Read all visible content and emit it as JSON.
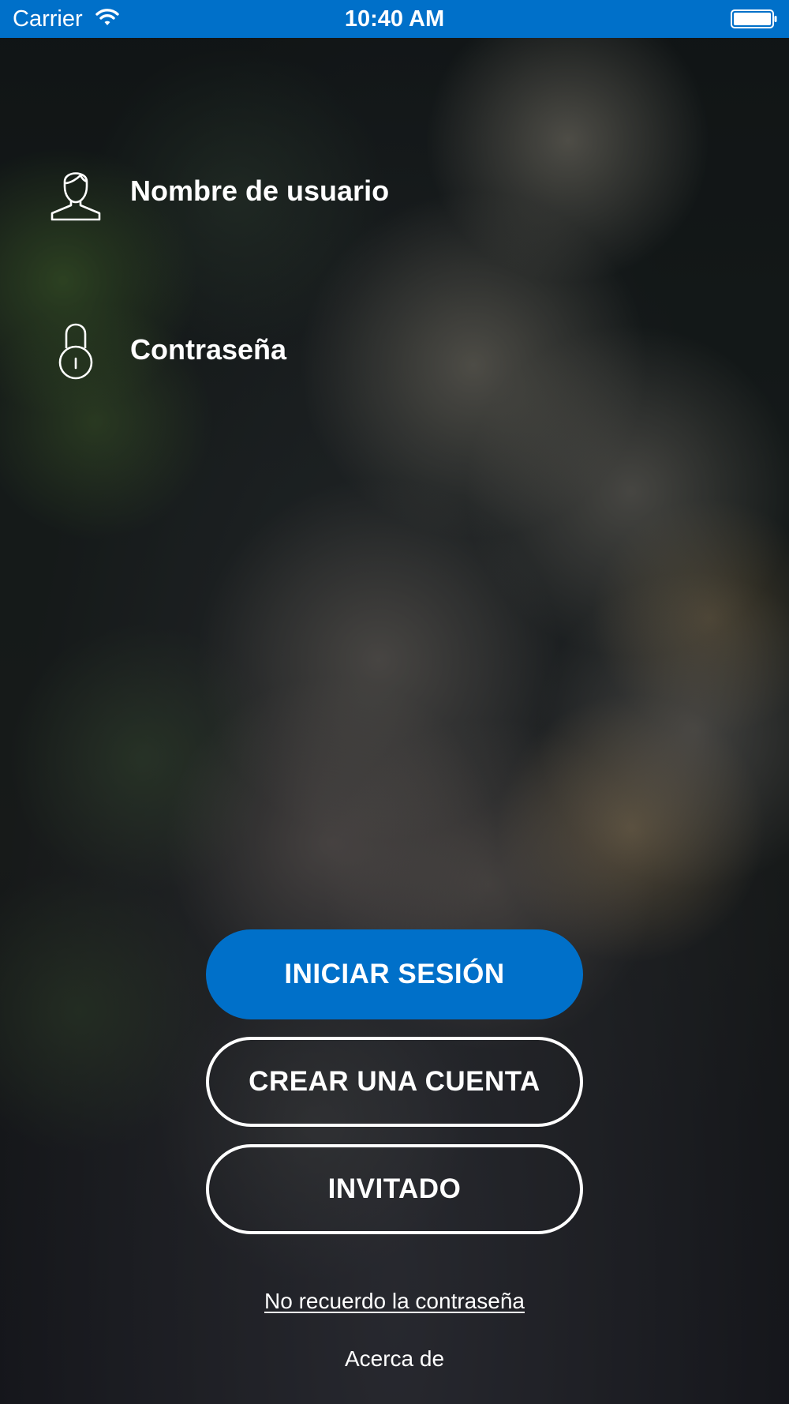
{
  "status_bar": {
    "carrier": "Carrier",
    "time": "10:40 AM",
    "background_color": "#0070c9",
    "wifi_icon": "wifi-icon",
    "battery_icon": "battery-icon"
  },
  "form": {
    "username": {
      "placeholder": "Nombre de usuario",
      "value": "",
      "icon": "user-icon"
    },
    "password": {
      "placeholder": "Contraseña",
      "value": "",
      "icon": "lock-icon"
    }
  },
  "buttons": {
    "login_label": "INICIAR SESIÓN",
    "create_account_label": "CREAR UNA CUENTA",
    "guest_label": "INVITADO",
    "primary_color": "#0070c9"
  },
  "links": {
    "forgot_password": "No recuerdo la contraseña",
    "about": "Acerca de"
  }
}
